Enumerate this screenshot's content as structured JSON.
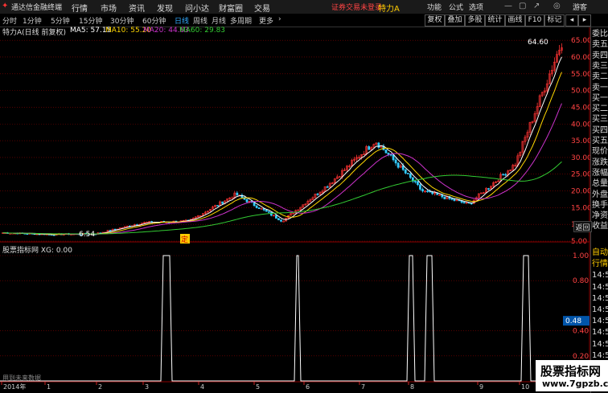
{
  "topbar": {
    "app_title": "通达信金融终端",
    "menus": [
      "行情",
      "市场",
      "资讯",
      "发现",
      "问小达",
      "财富圈",
      "交易"
    ],
    "notice": "证券交易未登录",
    "stock_label": "特力A",
    "right_items": [
      "功能",
      "公式",
      "选项"
    ],
    "guest": "游客"
  },
  "toolbar": {
    "periods": [
      "分时",
      "1分钟",
      "5分钟",
      "15分钟",
      "30分钟",
      "60分钟",
      "日线",
      "周线",
      "月线",
      "多周期",
      "更多"
    ],
    "active_period": "日线",
    "buttons": [
      "复权",
      "叠加",
      "多股",
      "统计",
      "画线",
      "F10",
      "标记"
    ]
  },
  "legend": {
    "stock": "特力A(日线 前复权)",
    "ma5": "MA5: 57.15",
    "ma10": "MA10: 55.20",
    "ma20": "MA20: 44.63",
    "ma60": "MA60: 29.83"
  },
  "colors": {
    "ma5": "#ffffff",
    "ma10": "#ffd700",
    "ma20": "#cc33cc",
    "ma60": "#33cc33",
    "up": "#ff3333",
    "down": "#33ccff",
    "grid": "#8b0000",
    "indicator": "#ffffff"
  },
  "price_axis": [
    "65.00",
    "60.00",
    "55.00",
    "50.00",
    "45.00",
    "40.00",
    "35.00",
    "30.00",
    "25.00",
    "20.00",
    "15.00",
    "10.00",
    "5.00"
  ],
  "annotations": {
    "high": "64.60",
    "low": "6.54",
    "marker": "定"
  },
  "indicator": {
    "title": "股票指标网 XG: 0.00",
    "axis": [
      "1.00",
      "0.80",
      "0.48",
      "0.40",
      "0.20"
    ],
    "current": "0.48",
    "footer": "用到未来数据"
  },
  "date_axis": [
    "2014年",
    "1",
    "2",
    "3",
    "4",
    "5",
    "6",
    "7",
    "8",
    "9",
    "10"
  ],
  "side_panel": {
    "top": [
      "委比",
      "卖五",
      "卖四",
      "卖三",
      "卖二",
      "卖一",
      "买一",
      "买二",
      "买三",
      "买四",
      "买五",
      "现价",
      "涨跌",
      "涨幅",
      "总量",
      "外盘",
      "换手",
      "净资",
      "收益"
    ],
    "bottom": [
      "自动",
      "行情",
      "14:5",
      "14:5",
      "14:5",
      "14:5",
      "14:5",
      "14:5",
      "14:5",
      "14:5",
      "14:5",
      "14:5"
    ],
    "back": "返回"
  },
  "watermark": {
    "title": "股票指标网",
    "url": "www.7gpzb.com"
  },
  "chart_data": {
    "type": "candlestick",
    "ylim": [
      5,
      66
    ],
    "x": [
      "2014-01",
      "2014-02",
      "2014-03",
      "2014-04",
      "2014-05",
      "2014-06",
      "2014-07",
      "2014-08",
      "2014-09",
      "2014-10"
    ],
    "close_trend": [
      7.5,
      7.0,
      7.2,
      10.5,
      11.0,
      19.0,
      11.0,
      22.0,
      35.0,
      20.0,
      16.0,
      28.0,
      64.6
    ],
    "high": 64.6,
    "low": 6.54,
    "signals": [
      0,
      0,
      1,
      1,
      0,
      1,
      0,
      1,
      1,
      0,
      1
    ]
  }
}
